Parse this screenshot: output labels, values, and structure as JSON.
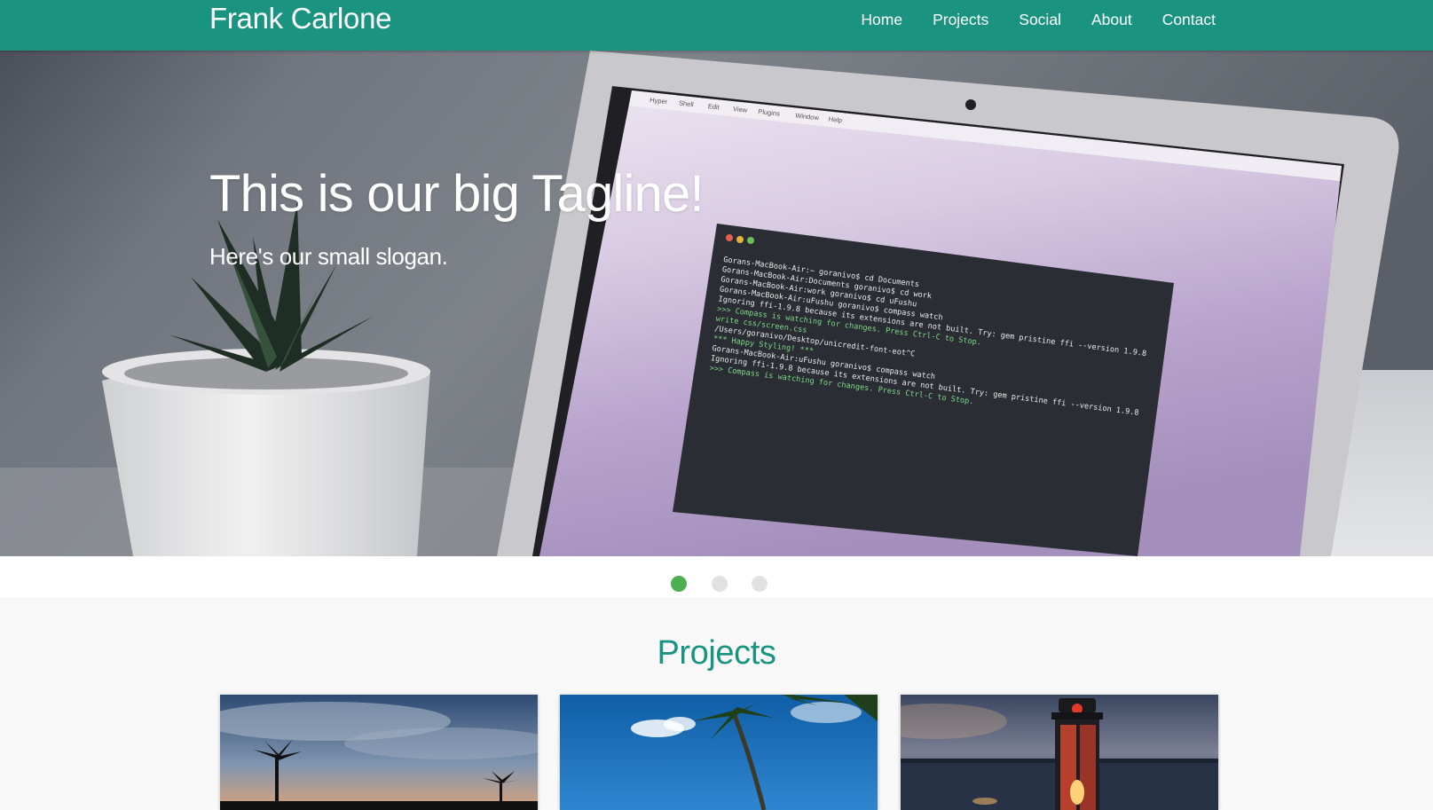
{
  "navbar": {
    "brand": "Frank Carlone",
    "links": [
      "Home",
      "Projects",
      "Social",
      "About",
      "Contact"
    ],
    "color": "#1a9480"
  },
  "hero": {
    "tagline": "This is our big Tagline!",
    "slogan": "Here's our small slogan.",
    "menubar_items": [
      "Hyper",
      "Shell",
      "Edit",
      "View",
      "Plugins",
      "Window",
      "Help"
    ],
    "terminal_lines": [
      "Gorans-MacBook-Air:~ goranivo$ cd Documents",
      "Gorans-MacBook-Air:Documents goranivo$ cd work",
      "Gorans-MacBook-Air:work goranivo$ cd uFushu",
      "Gorans-MacBook-Air:uFushu goranivo$ compass watch",
      "Ignoring ffi-1.9.8 because its extensions are not built.  Try: gem pristine ffi --version 1.9.8",
      ">>> Compass is watching for changes. Press Ctrl-C to Stop.",
      "    write css/screen.css",
      "/Users/goranivo/Desktop/unicredit-font-eot^C",
      "*** Happy Styling! ***",
      "Gorans-MacBook-Air:uFushu goranivo$ compass watch",
      "Ignoring ffi-1.9.8 because its extensions are not built.  Try: gem pristine ffi --version 1.9.8",
      ">>> Compass is watching for changes. Press Ctrl-C to Stop."
    ]
  },
  "carousel": {
    "slide_count": 3,
    "active_index": 0,
    "active_color": "#4caf50",
    "inactive_color": "#e1e1e1"
  },
  "projects": {
    "title": "Projects",
    "cards": [
      {
        "image": "palm-trees-sunset-thumbnail"
      },
      {
        "image": "palm-tree-blue-sky-thumbnail"
      },
      {
        "image": "lantern-lake-dusk-thumbnail"
      }
    ]
  }
}
